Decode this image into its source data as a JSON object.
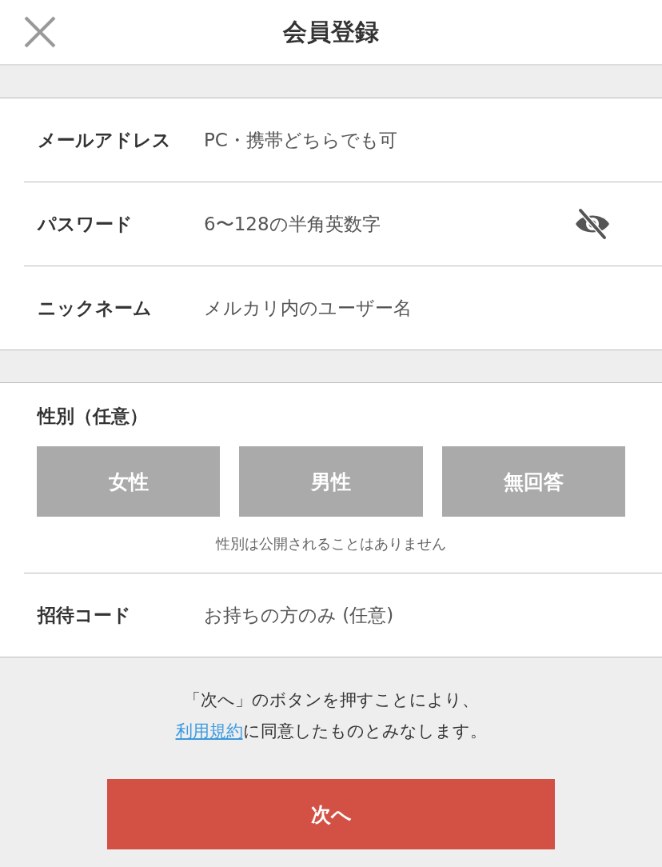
{
  "header": {
    "title": "会員登録"
  },
  "fields": [
    {
      "label": "メールアドレス",
      "placeholder": "PC・携帯どちらでも可",
      "kind": "text"
    },
    {
      "label": "パスワード",
      "placeholder": "6〜128の半角英数字",
      "kind": "password"
    },
    {
      "label": "ニックネーム",
      "placeholder": "メルカリ内のユーザー名",
      "kind": "text"
    }
  ],
  "gender": {
    "label": "性別（任意）",
    "options": [
      {
        "label": "女性",
        "selected": false
      },
      {
        "label": "男性",
        "selected": false
      },
      {
        "label": "無回答",
        "selected": false
      }
    ],
    "note": "性別は公開されることはありません"
  },
  "invite": {
    "label": "招待コード",
    "placeholder": "お持ちの方のみ (任意)"
  },
  "consent": {
    "before": "「次へ」のボタンを押すことにより、",
    "link": "利用規約",
    "after": "に同意したものとみなします。"
  },
  "next_button": "次へ"
}
